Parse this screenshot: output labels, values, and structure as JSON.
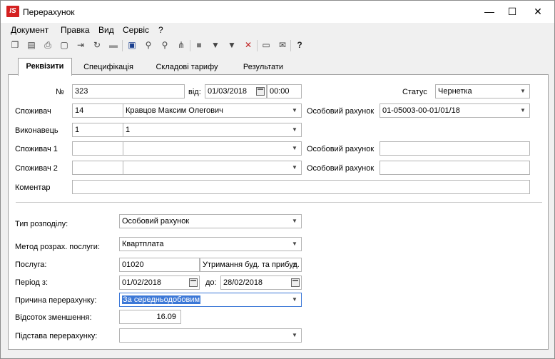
{
  "window": {
    "app_icon": "IS",
    "title": "Перерахунок",
    "controls": {
      "minimize": "—",
      "maximize": "☐",
      "close": "✕"
    }
  },
  "menu": [
    "Документ",
    "Правка",
    "Вид",
    "Сервіс",
    "?"
  ],
  "toolbar": {
    "icons": [
      "copy-icon",
      "paste-icon",
      "print-icon",
      "new-icon",
      "export-icon",
      "refresh-icon",
      "delete-icon",
      "save-icon",
      "find-icon",
      "find-next-icon",
      "tree-icon",
      "stop-icon",
      "filter-icon",
      "filter-set-icon",
      "filter-clear-icon",
      "document-icon",
      "mail-icon",
      "help-icon"
    ]
  },
  "tabs": [
    "Реквізити",
    "Специфікація",
    "Складові тарифу",
    "Результати"
  ],
  "form": {
    "number_label": "№",
    "number_value": "323",
    "date_label": "від:",
    "date_value": "01/03/2018",
    "time_value": "00:00",
    "status_label": "Статус",
    "status_value": "Чернетка",
    "consumer_label": "Споживач",
    "consumer_code": "14",
    "consumer_name": "Кравцов Максим Олегович",
    "personal_account_label": "Особовий рахунок",
    "personal_account_value": "01-05003-00-01/01/18",
    "executor_label": "Виконавець",
    "executor_code": "1",
    "executor_name": "1",
    "consumer1_label": "Споживач 1",
    "consumer1_code": "",
    "consumer1_name": "",
    "personal_account1_label": "Особовий рахунок",
    "personal_account1_value": "",
    "consumer2_label": "Споживач 2",
    "consumer2_code": "",
    "consumer2_name": "",
    "personal_account2_label": "Особовий рахунок",
    "personal_account2_value": "",
    "comment_label": "Коментар",
    "comment_value": ""
  },
  "details": {
    "distribution_type_label": "Тип розподілу:",
    "distribution_type_value": "Особовий рахунок",
    "calc_method_label": "Метод розрах. послуги:",
    "calc_method_value": "Квартплата",
    "service_label": "Послуга:",
    "service_code": "01020",
    "service_name": "Утримання буд. та прибуд. тер.",
    "period_label": "Період з:",
    "period_from": "01/02/2018",
    "period_to_label": "до:",
    "period_to": "28/02/2018",
    "reason_label": "Причина перерахунку:",
    "reason_value": "За середньодобовим",
    "reduction_label": "Відсоток зменшення:",
    "reduction_value": "16.09",
    "basis_label": "Підстава перерахунку:",
    "basis_value": ""
  }
}
